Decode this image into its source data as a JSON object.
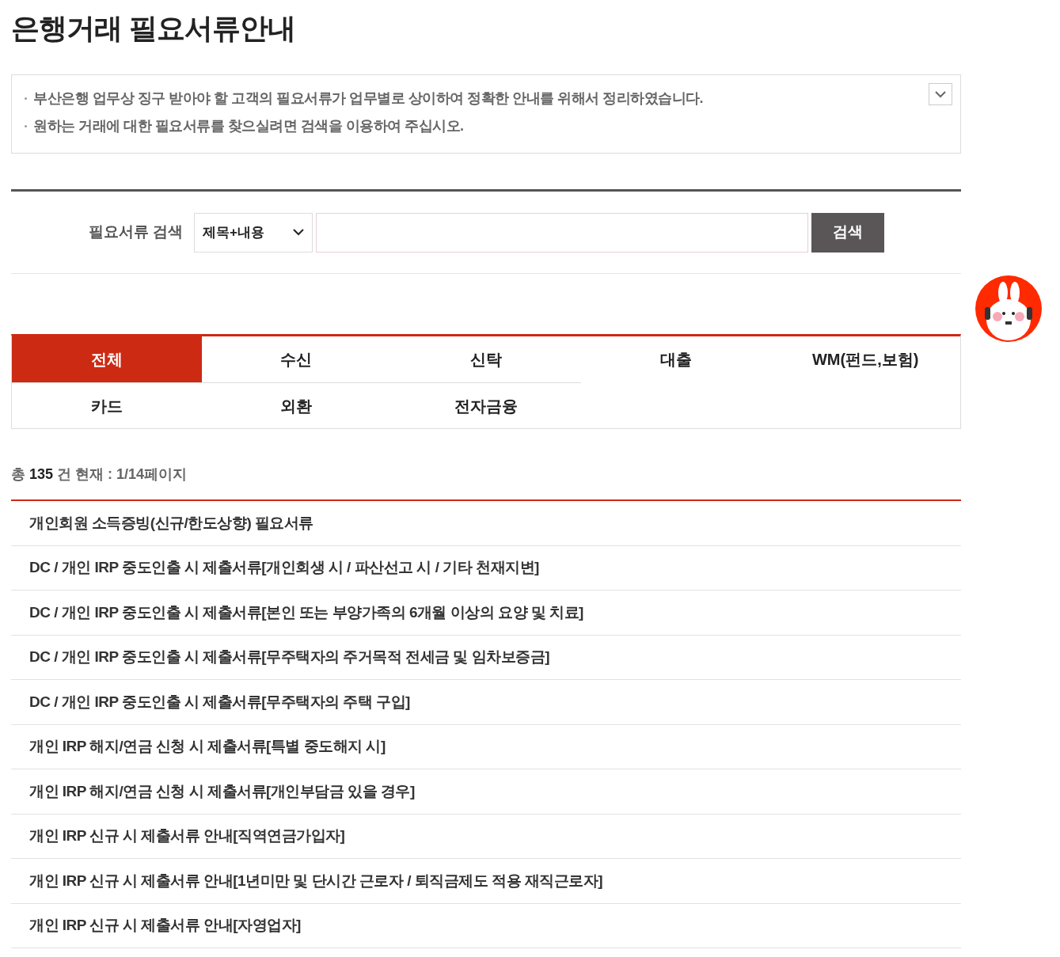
{
  "title": "은행거래 필요서류안내",
  "notice": {
    "lines": [
      "부산은행 업무상 징구 받아야 할 고객의 필요서류가 업무별로 상이하여 정확한 안내를 위해서 정리하였습니다.",
      "원하는 거래에 대한 필요서류를 찾으실려면 검색을 이용하여 주십시오."
    ],
    "expanded": false
  },
  "search": {
    "label": "필요서류 검색",
    "scope": "제목+내용",
    "button": "검색"
  },
  "tabs": [
    {
      "label": "전체",
      "selected": true
    },
    {
      "label": "수신",
      "selected": false
    },
    {
      "label": "신탁",
      "selected": false
    },
    {
      "label": "대출",
      "selected": false
    },
    {
      "label": "WM(펀드,보험)",
      "selected": false
    },
    {
      "label": "카드",
      "selected": false
    },
    {
      "label": "외환",
      "selected": false
    },
    {
      "label": "전자금융",
      "selected": false
    }
  ],
  "count": "총 **135**  건 현재 : 1/14페이지",
  "documents": [
    "개인회원 소득증빙(신규/한도상향) 필요서류",
    "DC / 개인 IRP 중도인출 시 제출서류[개인회생 시 / 파산선고 시 / 기타 천재지변]",
    "DC / 개인 IRP 중도인출 시 제출서류[본인 또는 부양가족의 6개월 이상의 요양 및 치료]",
    "DC / 개인 IRP 중도인출 시 제출서류[무주택자의 주거목적 전세금 및 임차보증금]",
    "DC / 개인 IRP 중도인출 시 제출서류[무주택자의 주택 구입]",
    "개인 IRP 해지/연금 신청 시 제출서류[특별 중도해지 시]",
    "개인 IRP 해지/연금 신청 시 제출서류[개인부담금 있을 경우]",
    "개인 IRP 신규 시 제출서류 안내[직역연금가입자]",
    "개인 IRP 신규 시 제출서류 안내[1년미만 및 단시간 근로자 / 퇴직금제도 적용 재직근로자]",
    "개인 IRP 신규 시 제출서류 안내[자영업자]"
  ]
}
